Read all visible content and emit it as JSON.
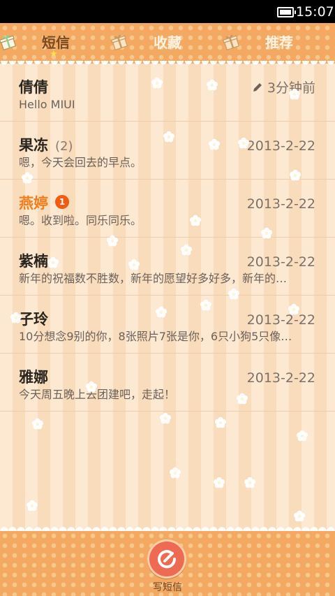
{
  "status_bar": {
    "time": "15:07"
  },
  "tabs": [
    {
      "label": "短信",
      "active": true
    },
    {
      "label": "收藏",
      "active": false
    },
    {
      "label": "推荐",
      "active": false
    }
  ],
  "messages": [
    {
      "name": "倩倩",
      "count": "",
      "badge": "",
      "date": "3分钟前",
      "draft_icon": "pencil-icon",
      "preview": "Hello MIUI",
      "unread": false
    },
    {
      "name": "果冻",
      "count": "(2)",
      "badge": "",
      "date": "2013-2-22",
      "preview": "嗯，今天会回去的早点。",
      "unread": false
    },
    {
      "name": "燕婷",
      "count": "",
      "badge": "1",
      "date": "2013-2-22",
      "preview": "嗯。收到啦。同乐同乐。",
      "unread": true
    },
    {
      "name": "紫楠",
      "count": "",
      "badge": "",
      "date": "2013-2-22",
      "preview": "新年的祝福数不胜数，新年的愿望好多好多，新年的…",
      "unread": false
    },
    {
      "name": "子玲",
      "count": "",
      "badge": "",
      "date": "2013-2-22",
      "preview": "10分想念9别的你，8张照片7张是你，6只小狗5只像…",
      "unread": false
    },
    {
      "name": "雅娜",
      "count": "",
      "badge": "",
      "date": "2013-2-22",
      "preview": "今天周五晚上去团建吧，走起！",
      "unread": false
    }
  ],
  "compose": {
    "label": "写短信",
    "icon": "compose-icon"
  },
  "colors": {
    "accent": "#f3a962",
    "unread_name": "#f07e1c",
    "badge": "#f25b11",
    "compose_button": "#ef6a52"
  }
}
